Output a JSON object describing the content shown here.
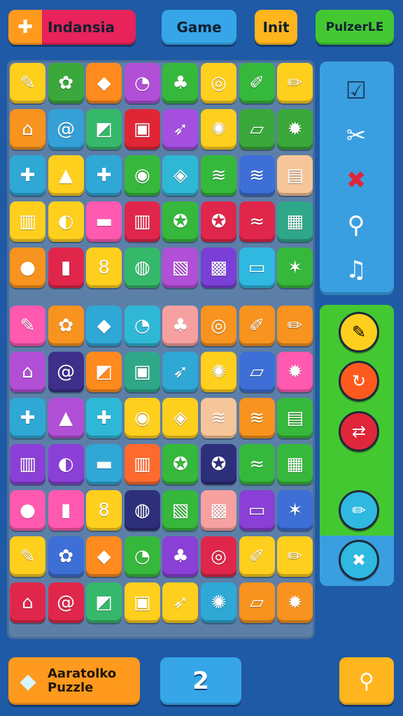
{
  "header": {
    "left_label": "Indansia",
    "game_label": "Game",
    "info_label": "Init",
    "puzzle_label": "PulzerLE"
  },
  "colors": {
    "background": "#1f5aa6",
    "board": "#5c7fa8",
    "side_blue": "#3a9fe0",
    "side_green": "#44c832"
  },
  "tiles_top": [
    [
      "#ffcf1e",
      "#3aa83a",
      "#ff8a1e",
      "#b14fd6",
      "#36b83c",
      "#ffcf1e",
      "#36b83c",
      "#ffcf1e"
    ],
    [
      "#f7931e",
      "#34a0d6",
      "#36b86a",
      "#e02634",
      "#a44fe0",
      "#ffcf1e",
      "#3aa83a",
      "#3aa83a"
    ],
    [
      "#2fa8d6",
      "#ffcf1e",
      "#2fa8d6",
      "#36b83c",
      "#2fb8d6",
      "#36b83c",
      "#3d6fd6",
      "#f7c59a"
    ],
    [
      "#ffcf1e",
      "#ffcf1e",
      "#ff59b0",
      "#e0264a",
      "#36b83c",
      "#e0264a",
      "#e0264a",
      "#2fa88a"
    ],
    [
      "#f7931e",
      "#e0264a",
      "#ffcf1e",
      "#36b86a",
      "#b14fd6",
      "#7a3fd6",
      "#2fb8e0",
      "#36b83c"
    ]
  ],
  "tiles_bottom": [
    [
      "#ff59b0",
      "#f7931e",
      "#2fa8d6",
      "#2fb8d6",
      "#f7a0a0",
      "#f7931e",
      "#f7931e",
      "#f7931e"
    ],
    [
      "#b14fd6",
      "#3d2f8a",
      "#ff8a1e",
      "#2fa88a",
      "#2fa8d6",
      "#ffcf1e",
      "#3d6fd6",
      "#ff59b0"
    ],
    [
      "#2fa8d6",
      "#b14fd6",
      "#2fb8d6",
      "#ffcf1e",
      "#ffcf1e",
      "#f7c59a",
      "#f7931e",
      "#36b83c"
    ],
    [
      "#8a3fd6",
      "#8a3fd6",
      "#2fa8d6",
      "#ff6a2e",
      "#36b83c",
      "#2d2f7a",
      "#36b83c",
      "#36b83c"
    ],
    [
      "#ff59b0",
      "#ff59b0",
      "#ffcf1e",
      "#2d2f7a",
      "#36b83c",
      "#f7a0a0",
      "#8a3fd6",
      "#3d6fd6"
    ],
    [
      "#ffcf1e",
      "#3d6fd6",
      "#ff8a1e",
      "#36b83c",
      "#8a3fd6",
      "#e0264a",
      "#ffcf1e",
      "#ffcf1e"
    ],
    [
      "#e0264a",
      "#e0264a",
      "#36b86a",
      "#ffcf1e",
      "#ffcf1e",
      "#2fa8d6",
      "#f7931e",
      "#f7931e"
    ]
  ],
  "footer": {
    "title_line1": "Aaratolko",
    "title_line2": "Puzzle",
    "counter": "2"
  }
}
